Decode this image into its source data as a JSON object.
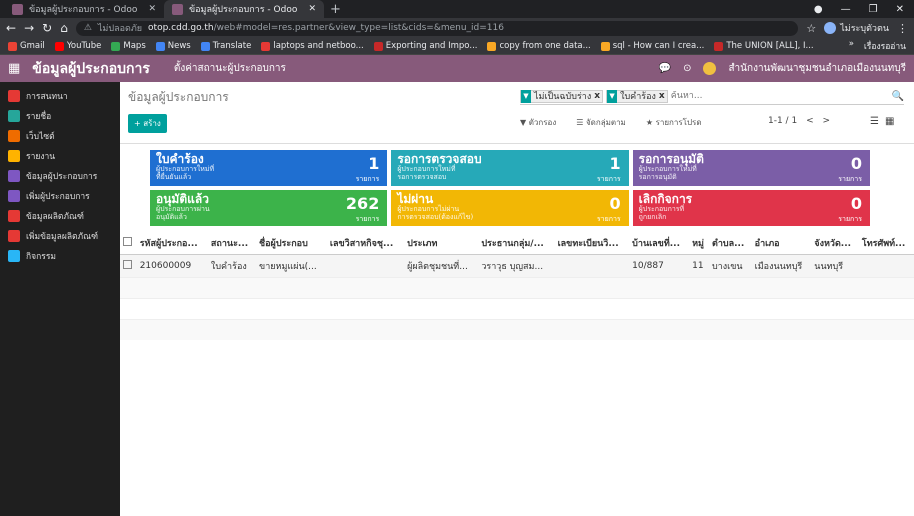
{
  "browser": {
    "tabs": [
      {
        "title": "ข้อมูลผู้ประกอบการ - Odoo"
      },
      {
        "title": "ข้อมูลผู้ประกอบการ - Odoo"
      }
    ],
    "url_security": "ไม่ปลอดภัย",
    "url_host": "otop.cdd.go.th",
    "url_path": "/web#model=res.partner&view_type=list&cids=&menu_id=116",
    "profile": "ไม่ระบุตัวตน",
    "bookmarks": [
      {
        "label": "Gmail",
        "color": "#ea4335"
      },
      {
        "label": "YouTube",
        "color": "#ff0000"
      },
      {
        "label": "Maps",
        "color": "#34a853"
      },
      {
        "label": "News",
        "color": "#4285f4"
      },
      {
        "label": "Translate",
        "color": "#4285f4"
      },
      {
        "label": "laptops and netboo...",
        "color": "#e53935"
      },
      {
        "label": "Exporting and Impo...",
        "color": "#c62828"
      },
      {
        "label": "copy from one data...",
        "color": "#f9a825"
      },
      {
        "label": "sql - How can I crea...",
        "color": "#f9a825"
      },
      {
        "label": "The UNION [ALL], I...",
        "color": "#c62828"
      }
    ],
    "bookmarks_more": "»",
    "reading_list": "เรื่องรออ่าน"
  },
  "odoo": {
    "brand": "ข้อมูลผู้ประกอบการ",
    "menu": "ตั้งค่าสถานะผู้ประกอบการ",
    "user": "สำนักงานพัฒนาชุมชนอำเภอเมืองนนทบุรี",
    "accent": "#875a7b"
  },
  "sidebar": {
    "items": [
      {
        "label": "การสนทนา",
        "color": "#e53935"
      },
      {
        "label": "รายชื่อ",
        "color": "#26a69a"
      },
      {
        "label": "เว็บไซต์",
        "color": "#ef6c00"
      },
      {
        "label": "รายงาน",
        "color": "#ffb300"
      },
      {
        "label": "ข้อมูลผู้ประกอบการ",
        "color": "#7e57c2"
      },
      {
        "label": "เพิ่มผู้ประกอบการ",
        "color": "#7e57c2"
      },
      {
        "label": "ข้อมูลผลิตภัณฑ์",
        "color": "#e53935"
      },
      {
        "label": "เพิ่มข้อมูลผลิตภัณฑ์",
        "color": "#e53935"
      },
      {
        "label": "กิจกรรม",
        "color": "#29b6f6"
      }
    ]
  },
  "control": {
    "breadcrumb": "ข้อมูลผู้ประกอบการ",
    "create": "+ สร้าง",
    "facets": [
      "ไม่เป็นฉบับร่าง",
      "ใบคำร้อง"
    ],
    "search_placeholder": "ค้นหา...",
    "filters": "ตัวกรอง",
    "groupby": "จัดกลุ่มตาม",
    "favorites": "รายการโปรด",
    "pager": "1-1 / 1",
    "prev": "<",
    "next": ">"
  },
  "cards": [
    {
      "title": "ใบคำร้อง",
      "sub1": "ผู้ประกอบการใหม่ที่",
      "sub2": "ที่ยื่นยันแล้ว",
      "count": "1",
      "unit": "รายการ",
      "color": "#1f6fd1"
    },
    {
      "title": "รอการตรวจสอบ",
      "sub1": "ผู้ประกอบการใหม่ที่",
      "sub2": "รอการตรวจสอบ",
      "count": "1",
      "unit": "รายการ",
      "color": "#26a9b8"
    },
    {
      "title": "รอการอนุมัติ",
      "sub1": "ผู้ประกอบการใหม่ที่",
      "sub2": "รอการอนุมัติ",
      "count": "0",
      "unit": "รายการ",
      "color": "#7b5ea7"
    },
    {
      "title": "อนุมัติแล้ว",
      "sub1": "ผู้ประกอบการผ่าน",
      "sub2": "อนุมัติแล้ว",
      "count": "262",
      "unit": "รายการ",
      "color": "#3cb34a"
    },
    {
      "title": "ไม่ผ่าน",
      "sub1": "ผู้ประกอบการไม่ผ่าน",
      "sub2": "การตรวจสอบ(ต้องแก้ไข)",
      "count": "0",
      "unit": "รายการ",
      "color": "#f2b705"
    },
    {
      "title": "เลิกกิจการ",
      "sub1": "ผู้ประกอบการที่",
      "sub2": "ถูกยกเลิก",
      "count": "0",
      "unit": "รายการ",
      "color": "#e0344a"
    }
  ],
  "table": {
    "headers": [
      "รหัสผู้ประกอ...",
      "สถานะ...",
      "ชื่อผู้ประกอบ",
      "เลขวิสาหกิจชุ...",
      "ประเภท",
      "ประธานกลุ่ม/...",
      "เลขทะเบียนวิ...",
      "บ้านเลขที่...",
      "หมู่",
      "ตำบล...",
      "อำเภอ",
      "จังหวัด...",
      "โทรศัพท์..."
    ],
    "rows": [
      [
        "210600009",
        "ใบคำร้อง",
        "ขายหมูแผ่น(...",
        "",
        "ผู้ผลิตชุมชนที่...",
        "วราวุธ บุญสม...",
        "",
        "10/887",
        "11",
        "บางเขน",
        "เมืองนนทบุรี",
        "นนทบุรี",
        ""
      ]
    ]
  }
}
